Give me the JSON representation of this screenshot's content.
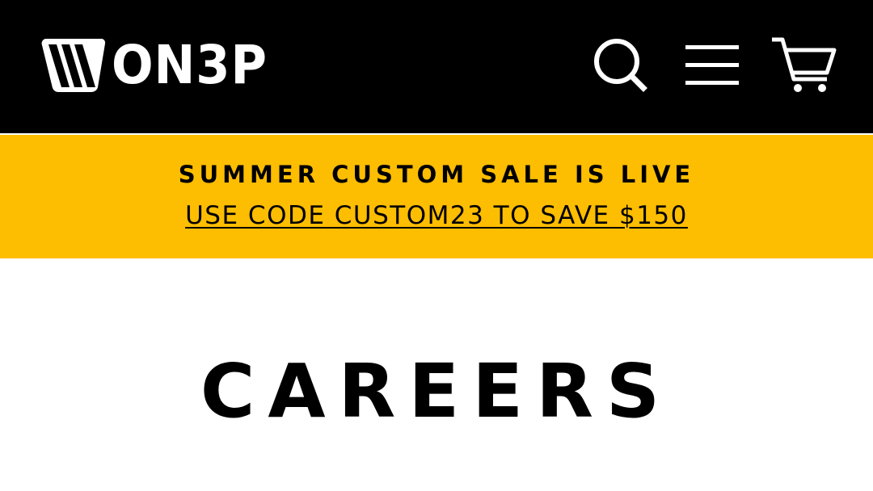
{
  "header": {
    "logo_text": "ON3P",
    "icons": {
      "search": "search-icon",
      "menu": "hamburger-menu-icon",
      "cart": "shopping-cart-icon"
    }
  },
  "promo": {
    "title": "SUMMER CUSTOM SALE IS LIVE",
    "link_text": "USE CODE CUSTOM23 TO SAVE $150"
  },
  "main": {
    "page_title": "CAREERS"
  },
  "colors": {
    "header_bg": "#000000",
    "promo_bg": "#fdbd00",
    "text": "#000000",
    "header_icons": "#ffffff"
  }
}
